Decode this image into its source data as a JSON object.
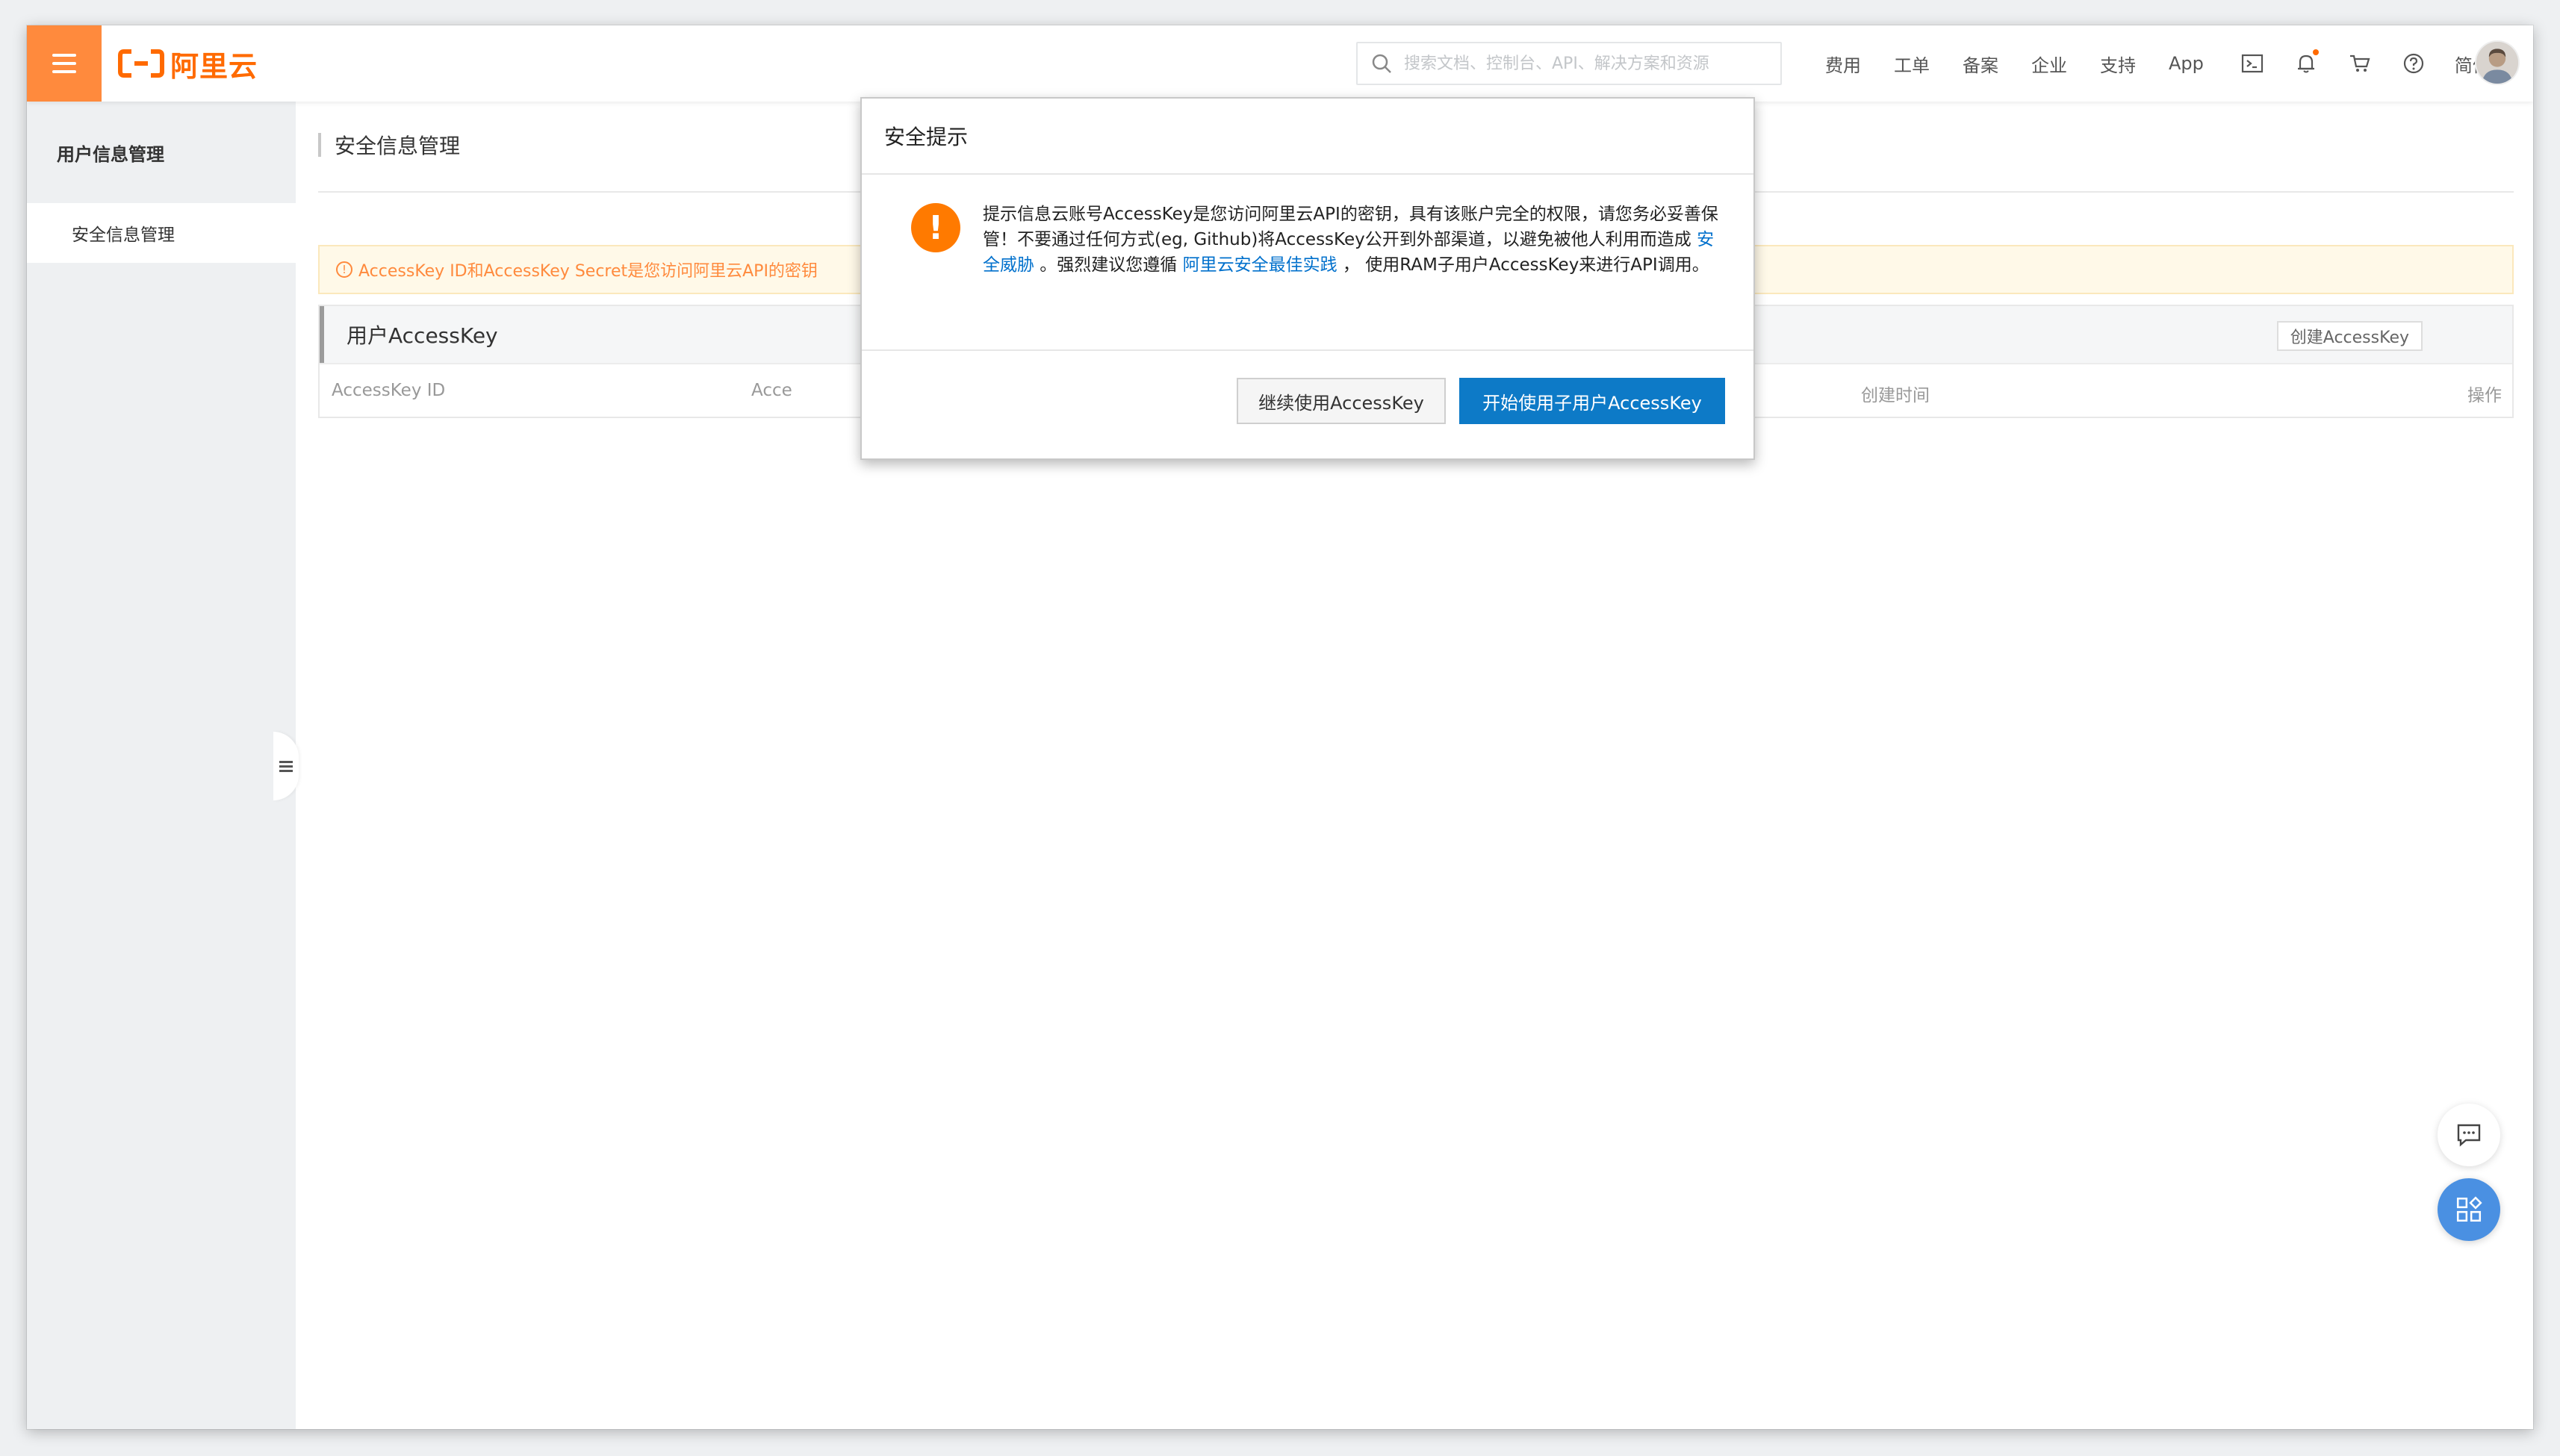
{
  "brand": {
    "name": "阿里云",
    "color": "#ff6a00"
  },
  "header": {
    "search_placeholder": "搜索文档、控制台、API、解决方案和资源",
    "nav": [
      "费用",
      "工单",
      "备案",
      "企业",
      "支持",
      "App"
    ],
    "language": "简体",
    "icons": [
      "terminal-icon",
      "bell-icon",
      "cart-icon",
      "help-icon"
    ]
  },
  "sidebar": {
    "title": "用户信息管理",
    "items": [
      {
        "label": "安全信息管理"
      }
    ]
  },
  "main": {
    "page_title": "安全信息管理",
    "alert_text": "AccessKey ID和AccessKey Secret是您访问阿里云API的密钥",
    "alert_icon": "!",
    "key_panel": {
      "title": "用户AccessKey",
      "create_button": "创建AccessKey",
      "columns": {
        "id": "AccessKey ID",
        "secret": "Acce",
        "created": "创建时间",
        "actions": "操作"
      }
    }
  },
  "modal": {
    "title": "安全提示",
    "icon": "!",
    "body_1": "提示信息云账号AccessKey是您访问阿里云API的密钥，具有该账户完全的权限，请您务必妥善保管！不要通过任何方式(eg, Github)将AccessKey公开到外部渠道，以避免被他人利用而造成 ",
    "link_1": "安全威胁",
    "body_2": " 。强烈建议您遵循 ",
    "link_2": "阿里云安全最佳实践",
    "body_3": " ， 使用RAM子用户AccessKey来进行API调用。",
    "secondary_button": "继续使用AccessKey",
    "primary_button": "开始使用子用户AccessKey",
    "primary_color": "#0d7ac7",
    "warning_color": "#ff7a00"
  }
}
